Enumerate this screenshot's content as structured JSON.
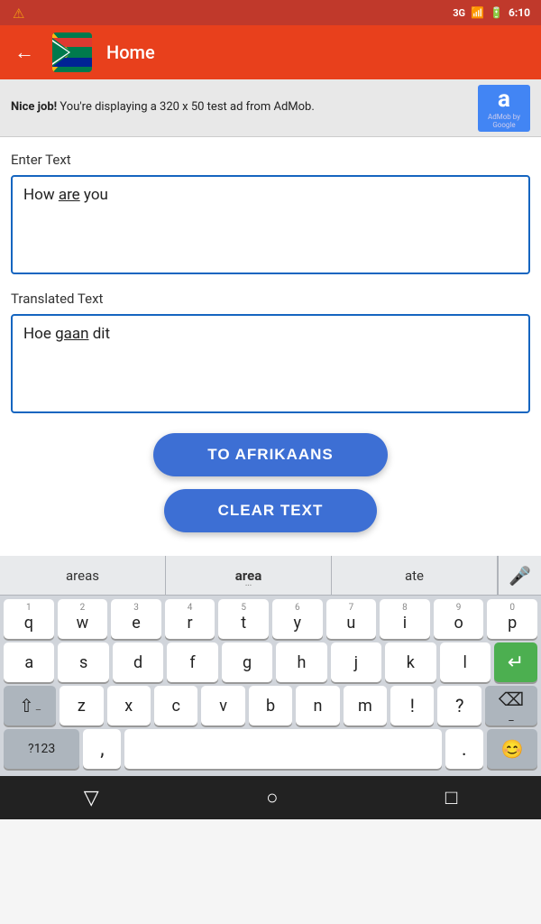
{
  "status_bar": {
    "signal": "3G",
    "battery": "🔋",
    "time": "6:10"
  },
  "top_bar": {
    "title": "Home",
    "back_label": "←"
  },
  "ad": {
    "text_bold": "Nice job!",
    "text_normal": " You're displaying a 320 x 50 test ad from AdMob.",
    "logo_letter": "a",
    "logo_sub": "AdMob by Google"
  },
  "enter_text_label": "Enter Text",
  "input_text": "How are you",
  "translated_text_label": "Translated Text",
  "translated_text": "Hoe gaan dit",
  "buttons": {
    "to_afrikaans": "TO AFRIKAANS",
    "clear_text": "CLEAR TEXT"
  },
  "keyboard": {
    "suggestions": [
      "areas",
      "area",
      "ate"
    ],
    "row1": {
      "nums": [
        "1",
        "2",
        "3",
        "4",
        "5",
        "6",
        "7",
        "8",
        "9",
        "0"
      ],
      "keys": [
        "q",
        "w",
        "e",
        "r",
        "t",
        "y",
        "u",
        "i",
        "o",
        "p"
      ]
    },
    "row2": {
      "keys": [
        "a",
        "s",
        "d",
        "f",
        "g",
        "h",
        "j",
        "k",
        "l"
      ]
    },
    "row3": {
      "keys": [
        "z",
        "x",
        "c",
        "v",
        "b",
        "n",
        "m"
      ]
    },
    "bottom_row": {
      "sym": "?123",
      "comma": ",",
      "space": "",
      "period": ".",
      "emoji": "😊"
    }
  },
  "bottom_nav": {
    "back": "▽",
    "home": "○",
    "recent": "□"
  }
}
